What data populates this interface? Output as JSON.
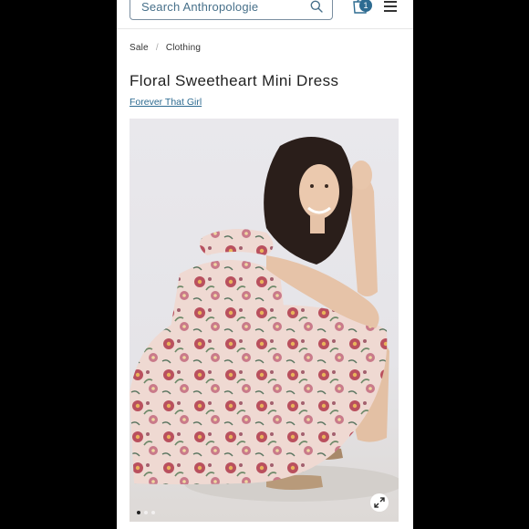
{
  "header": {
    "search_placeholder": "Search Anthropologie",
    "bag_count": "1",
    "icons": [
      "search-icon",
      "shopping-bag-icon",
      "hamburger-menu-icon"
    ]
  },
  "breadcrumb": {
    "items": [
      "Sale",
      "Clothing"
    ],
    "separator": "/"
  },
  "product": {
    "title": "Floral Sweetheart Mini Dress",
    "brand": "Forever That Girl"
  },
  "gallery": {
    "slide_count": 3,
    "active_slide": 1,
    "expand_icon": "expand-icon"
  },
  "colors": {
    "accent": "#2d6b91",
    "page_bg": "#ffffff",
    "outer_bg": "#000000"
  }
}
